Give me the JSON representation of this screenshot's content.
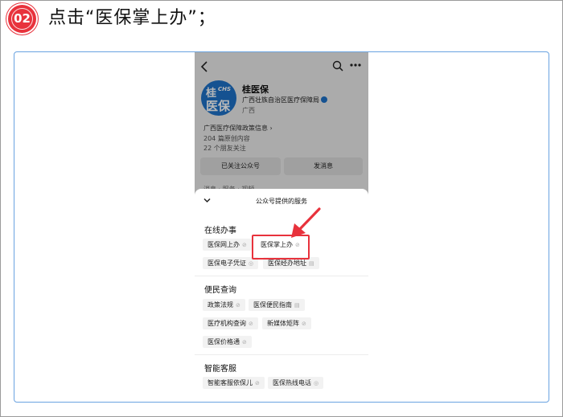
{
  "header": {
    "step_number": "02",
    "title": "点击“医保掌上办”；"
  },
  "account": {
    "logo_line1": "桂",
    "logo_chs": "CHS",
    "logo_line2": "医保",
    "name": "桂医保",
    "org": "广西壮族自治区医疗保障局",
    "region": "广西",
    "info_line1": "广西医疗保障政策信息 ›",
    "info_line2": "204 篇原创内容",
    "info_line3": "22 个朋友关注",
    "follow_button": "已关注公众号",
    "message_button": "发消息",
    "tabs_hint": "消息 · 服务 · 视频"
  },
  "sheet": {
    "title": "公众号提供的服务",
    "sections": [
      {
        "title": "在线办事",
        "items": [
          "医保网上办",
          "医保掌上办",
          "医保电子凭证",
          "医保经办地址"
        ]
      },
      {
        "title": "便民查询",
        "items": [
          "政策法规",
          "医保便民指南",
          "医疗机构查询",
          "新媒体矩阵",
          "医保价格通"
        ]
      },
      {
        "title": "智能客服",
        "items": [
          "智能客服依保儿",
          "医保热线电话"
        ]
      }
    ]
  },
  "colors": {
    "accent_red": "#e8323c",
    "frame_blue": "#6aa3e0",
    "logo_blue": "#1e72c9"
  }
}
